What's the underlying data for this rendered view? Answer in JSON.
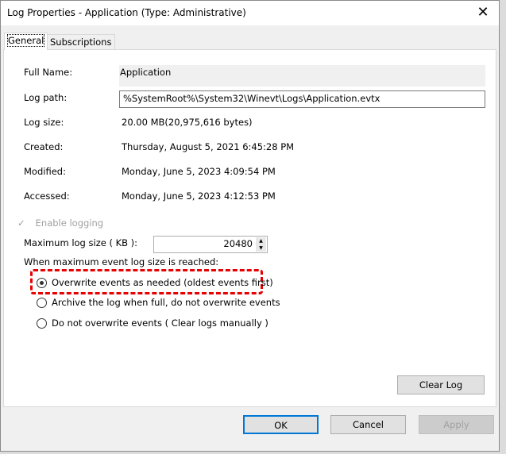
{
  "window": {
    "title": "Log Properties - Application (Type: Administrative)",
    "close_glyph": "✕"
  },
  "tabs": [
    {
      "label": "General"
    },
    {
      "label": "Subscriptions"
    }
  ],
  "general": {
    "full_name_label": "Full Name:",
    "full_name": "Application",
    "log_path_label": "Log path:",
    "log_path": "%SystemRoot%\\System32\\Winevt\\Logs\\Application.evtx",
    "log_size_label": "Log size:",
    "log_size": "20.00 MB(20,975,616 bytes)",
    "created_label": "Created:",
    "created": "Thursday, August 5, 2021 6:45:28 PM",
    "modified_label": "Modified:",
    "modified": "Monday, June 5, 2023 4:09:54 PM",
    "accessed_label": "Accessed:",
    "accessed": "Monday, June 5, 2023 4:12:53 PM",
    "enable_logging": "Enable logging",
    "max_size_label": "Maximum log size ( KB ):",
    "max_size": "20480",
    "policy_label": "When maximum event log size is reached:",
    "options": [
      "Overwrite events as needed (oldest events first)",
      "Archive the log when full, do not overwrite events",
      "Do not overwrite events ( Clear logs manually )"
    ],
    "clear_log": "Clear Log"
  },
  "buttons": {
    "ok": "OK",
    "cancel": "Cancel",
    "apply": "Apply"
  }
}
